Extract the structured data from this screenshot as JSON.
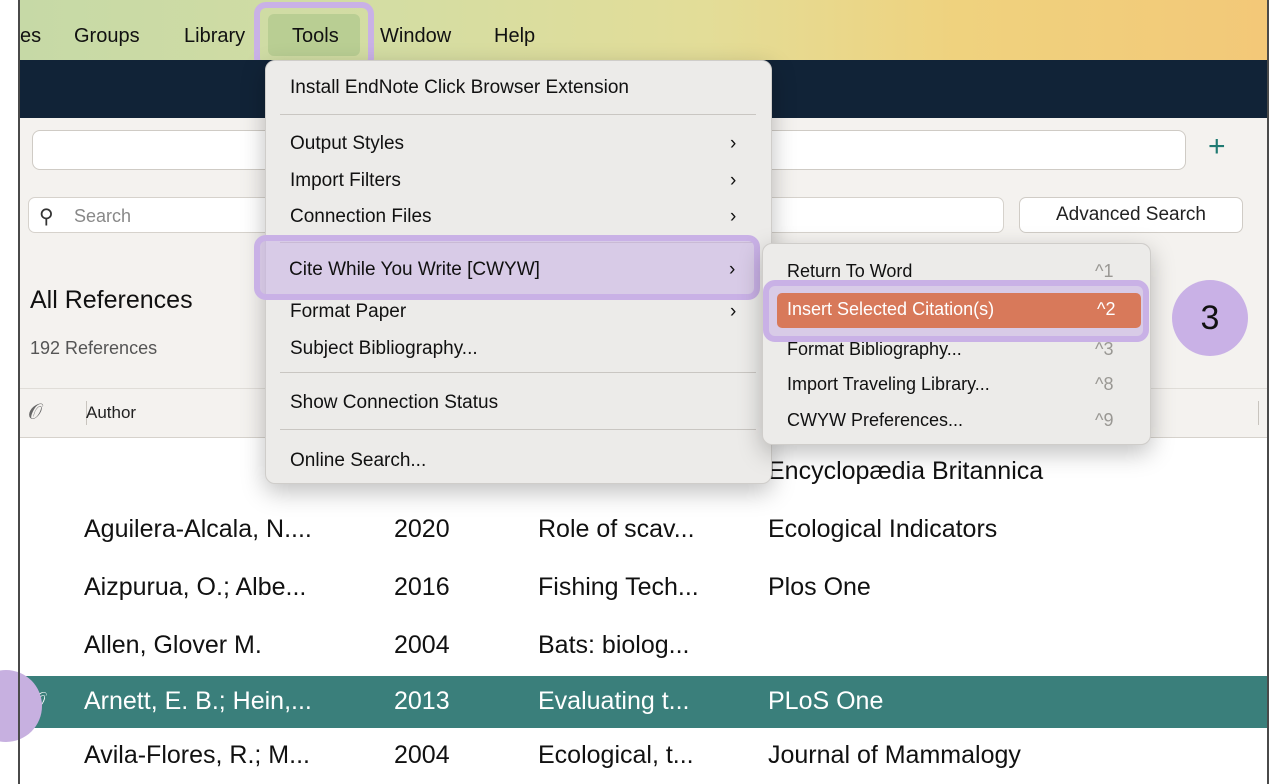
{
  "menubar": {
    "items": [
      "es",
      "Groups",
      "Library",
      "Tools",
      "Window",
      "Help"
    ]
  },
  "toolbar": {
    "add_symbol": "+"
  },
  "search": {
    "icon": "search-icon",
    "placeholder": "Search",
    "advanced_label": "Advanced Search"
  },
  "library": {
    "title": "All References",
    "count": "192 References"
  },
  "columns": {
    "attachment_icon": "paperclip-icon",
    "author": "Author"
  },
  "rows": [
    {
      "author": "",
      "year": "",
      "title": "",
      "journal": "Encyclopædia Britannica",
      "attachment": false,
      "selected": false
    },
    {
      "author": "Aguilera-Alcala, N....",
      "year": "2020",
      "title": "Role of scav...",
      "journal": "Ecological Indicators",
      "attachment": false,
      "selected": false
    },
    {
      "author": "Aizpurua, O.; Albe...",
      "year": "2016",
      "title": "Fishing Tech...",
      "journal": "Plos One",
      "attachment": false,
      "selected": false
    },
    {
      "author": "Allen, Glover M.",
      "year": "2004",
      "title": "Bats: biolog...",
      "journal": "",
      "attachment": false,
      "selected": false
    },
    {
      "author": "Arnett, E. B.; Hein,...",
      "year": "2013",
      "title": "Evaluating t...",
      "journal": "PLoS One",
      "attachment": true,
      "selected": true
    },
    {
      "author": "Avila-Flores, R.; M...",
      "year": "2004",
      "title": "Ecological, t...",
      "journal": "Journal of Mammalogy",
      "attachment": false,
      "selected": false
    }
  ],
  "tools_menu": {
    "items": [
      {
        "label": "Install EndNote Click Browser Extension",
        "submenu": false
      },
      {
        "label": "Output Styles",
        "submenu": true
      },
      {
        "label": "Import Filters",
        "submenu": true
      },
      {
        "label": "Connection Files",
        "submenu": true
      },
      {
        "label": "Cite While You Write [CWYW]",
        "submenu": true
      },
      {
        "label": "Format Paper",
        "submenu": true
      },
      {
        "label": "Subject Bibliography...",
        "submenu": false
      },
      {
        "label": "Show Connection Status",
        "submenu": false
      },
      {
        "label": "Online Search...",
        "submenu": false
      }
    ],
    "arrow": "›"
  },
  "cwyw_submenu": {
    "items": [
      {
        "label": "Return To Word",
        "shortcut": "^1"
      },
      {
        "label": "Insert Selected Citation(s)",
        "shortcut": "^2"
      },
      {
        "label": "Format Bibliography...",
        "shortcut": "^3"
      },
      {
        "label": "Import Traveling Library...",
        "shortcut": "^8"
      },
      {
        "label": "CWYW Preferences...",
        "shortcut": "^9"
      }
    ]
  },
  "annotation": {
    "step": "3"
  },
  "colors": {
    "accent": "#3a7f7b",
    "highlight": "#c9b1e6",
    "selected_menu": "#d8795a",
    "navy": "#112337"
  }
}
